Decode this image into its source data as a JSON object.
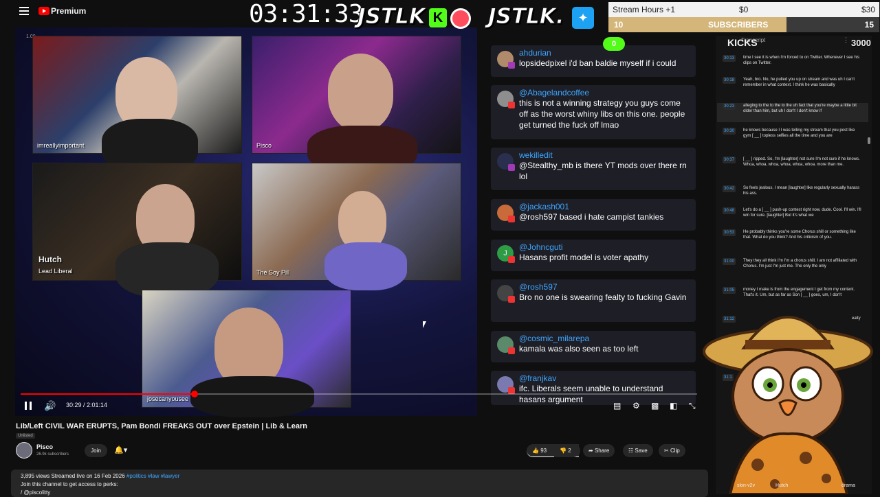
{
  "header": {
    "brand": "Premium",
    "timer": "03:31:33",
    "overlay_logo_left": "JSTLK",
    "overlay_logo_right": "JSTLK.",
    "kick_badge": "K"
  },
  "hud": {
    "stream_hours": "Stream Hours +1",
    "money_current": "$0",
    "money_goal": "$30",
    "subs_count": "10",
    "subs_label": "SUBSCRIBERS",
    "subs_goal": "15",
    "kicks_label": "KICKS",
    "kicks_current": "0",
    "kicks_goal": "3000",
    "transcript_label": "Transcript"
  },
  "cams": [
    {
      "label": "imreallyimportant"
    },
    {
      "label": "Pisco"
    },
    {
      "label": "Hutch",
      "sublabel": "Lead Liberal"
    },
    {
      "label": "The Soy Pill"
    },
    {
      "label": "josecanyousee"
    }
  ],
  "chat": [
    {
      "user": "ahdurian",
      "text": "lopsidedpixel i'd ban baldie myself if i could",
      "avatar": "#b08a6a"
    },
    {
      "user": "@Abagelandcoffee",
      "text": "this is not a winning strategy you guys come off as the worst whiny libs on this one. people get turned the fuck off lmao",
      "avatar": "#8e8e8e"
    },
    {
      "user": "wekilledit",
      "text": "@Stealthy_mb is there YT mods over there rn lol",
      "avatar": "#2a2f4f"
    },
    {
      "user": "@jackash001",
      "text": "@rosh597 based i hate campist tankies",
      "avatar": "#c96a3a"
    },
    {
      "user": "@Johncguti",
      "text": "Hasans profit model is voter apathy",
      "avatar": "#2e9b45"
    },
    {
      "user": "@rosh597",
      "text": "Bro no one is swearing fealty to fucking Gavin",
      "avatar": "#444"
    },
    {
      "user": "@cosmic_milarepa",
      "text": "kamala was also seen as too left",
      "avatar": "#5a8a6a"
    },
    {
      "user": "@franjkav",
      "text": "ifc. Liberals seem unable to understand hasans argument",
      "avatar": "#7a7ab0"
    }
  ],
  "player": {
    "time": "30:29 / 2:01:14",
    "progress": 0.25
  },
  "video": {
    "title": "Lib/Left CIVIL WAR ERUPTS, Pam Bondi FREAKS OUT over Epstein | Lib & Learn",
    "visibility": "Unlisted",
    "channel": "Pisco",
    "subscribers": "26.9k subscribers",
    "join": "Join",
    "likes": "93",
    "dislikes": "2",
    "share": "Share",
    "save": "Save",
    "clip": "Clip"
  },
  "description": {
    "stats": "3,895 views  Streamed live on 16 Feb 2026",
    "tags": "#politics #law #lawyer",
    "line2": "Join this channel to get access to perks:",
    "line3": "/ @piscolitty"
  },
  "transcript": [
    {
      "time": "30:13",
      "text": "time I see it is when I'm forced to on Twitter. Whenever I see his clips on Twitter."
    },
    {
      "time": "30:18",
      "text": "Yeah, bro. No, he pulled you up on stream and was uh I can't remember in what context. I think he was basically"
    },
    {
      "time": "30:23",
      "text": "alleging to the to the to the uh fact that you're maybe a little bit older than him, but uh I don't I don't know if"
    },
    {
      "time": "30:30",
      "text": "he knows because I I was telling my stream that you post like gym [ __ ] topless selfies all the time and you are"
    },
    {
      "time": "30:37",
      "text": "[ __ ] ripped. So, I'm [laughter] not sure I'm not sure if he knows. Whoa, whoa, whoa, whoa, whoa, whoa. more than me."
    },
    {
      "time": "30:42",
      "text": "So feels jealous. I mean [laughter] like regularly sexually harass his ass."
    },
    {
      "time": "30:48",
      "text": "Let's do a [ __ ] push-up contest right now, dude. Cool. I'll win. I'll win for sure. [laughter] But it's what we"
    },
    {
      "time": "30:53",
      "text": "He probably thinks you're some Chorus shill or something like that. What do you think? And his criticism of you."
    },
    {
      "time": "31:00",
      "text": "They they all think I'm I'm a chorus shill. I am not affiliated with Chorus. I'm just I'm just me. The only the only"
    },
    {
      "time": "31:05",
      "text": "money I make is from the engagement I get from my content. That's it. Um, but as far as Son [ __ ] goes, um, I don't"
    },
    {
      "time": "31:12",
      "text": "ealty"
    },
    {
      "time": "31:1",
      "text": ""
    }
  ],
  "footer_tags": {
    "left": "slon-v2v",
    "middle": "Hutch",
    "right": "drama"
  }
}
